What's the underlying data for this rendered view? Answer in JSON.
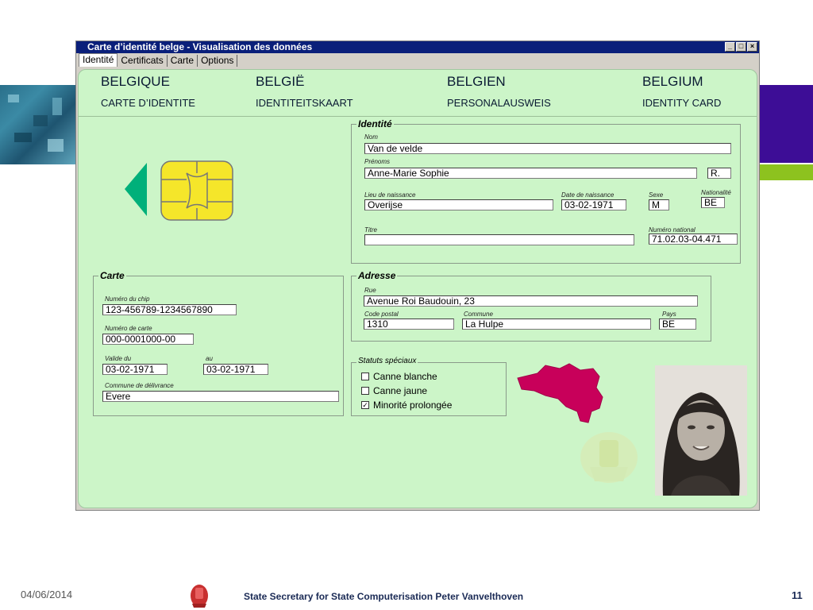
{
  "window": {
    "title": "Carte d’identité belge - Visualisation des données",
    "minimize": "_",
    "maximize": "□",
    "close": "×"
  },
  "tabs": [
    "Identité",
    "Certificats",
    "Carte",
    "Options"
  ],
  "header": {
    "fr_country": "BELGIQUE",
    "fr_card": "CARTE D’IDENTITE",
    "nl_country": "BELGIË",
    "nl_card": "IDENTITEITSKAART",
    "de_country": "BELGIEN",
    "de_card": "PERSONALAUSWEIS",
    "en_country": "BELGIUM",
    "en_card": "IDENTITY CARD"
  },
  "identite": {
    "legend": "Identité",
    "nom_label": "Nom",
    "nom": "Van de velde",
    "prenoms_label": "Prénoms",
    "prenoms": "Anne-Marie Sophie",
    "initiale": "R.",
    "lieu_label": "Lieu de naissance",
    "lieu": "Overijse",
    "date_label": "Date de naissance",
    "date": "03-02-1971",
    "sexe_label": "Sexe",
    "sexe": "M",
    "nationalite_label": "Nationalité",
    "nationalite": "BE",
    "titre_label": "Titre",
    "titre": "",
    "numero_label": "Numéro national",
    "numero": "71.02.03-04.471"
  },
  "carte": {
    "legend": "Carte",
    "chip_label": "Numéro du chip",
    "chip": "123-456789-1234567890",
    "numero_label": "Numéro de carte",
    "numero": "000-0001000-00",
    "valide_label": "Valide du",
    "valide_du": "03-02-1971",
    "au_label": "au",
    "au": "03-02-1971",
    "commune_label": "Commune de délivrance",
    "commune": "Evere"
  },
  "adresse": {
    "legend": "Adresse",
    "rue_label": "Rue",
    "rue": "Avenue Roi Baudouin, 23",
    "cp_label": "Code postal",
    "cp": "1310",
    "commune_label": "Commune",
    "commune": "La Hulpe",
    "pays_label": "Pays",
    "pays": "BE"
  },
  "statuts": {
    "legend": "Statuts spéciaux",
    "items": [
      {
        "label": "Canne blanche",
        "checked": false,
        "mark": ""
      },
      {
        "label": "Canne jaune",
        "checked": false,
        "mark": ""
      },
      {
        "label": "Minorité prolongée",
        "checked": true,
        "mark": "✓"
      }
    ]
  },
  "colors": {
    "panel": "#ccf5c8",
    "titlebar": "#0a1f7a",
    "chip": "#f5e62a",
    "map": "#c8005a",
    "arrow": "#00b07a"
  },
  "footer": {
    "date": "04/06/2014",
    "text": "State Secretary for State Computerisation Peter Vanvelthoven",
    "page": "11"
  }
}
